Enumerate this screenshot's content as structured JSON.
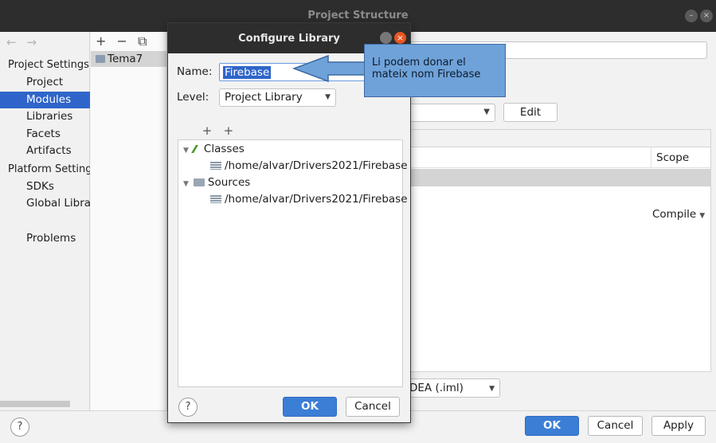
{
  "window": {
    "title": "Project Structure",
    "controls": [
      "minimize",
      "close"
    ]
  },
  "nav": {
    "back": "←",
    "forward": "→"
  },
  "sidebar": {
    "section_project": "Project Settings",
    "section_platform": "Platform Settings",
    "items_project": [
      {
        "label": "Project"
      },
      {
        "label": "Modules",
        "selected": true
      },
      {
        "label": "Libraries"
      },
      {
        "label": "Facets"
      },
      {
        "label": "Artifacts"
      }
    ],
    "items_platform": [
      {
        "label": "SDKs"
      },
      {
        "label": "Global Libraries"
      }
    ],
    "problems": "Problems"
  },
  "modules": {
    "tools": [
      "+",
      "−",
      "⧉"
    ],
    "items": [
      {
        "label": "Tema7"
      }
    ]
  },
  "module_panel": {
    "edit_label": "Edit",
    "scope_header": "Scope",
    "compile": "Compile",
    "storage_format": "DEA (.iml)"
  },
  "footer": {
    "help": "?",
    "ok": "OK",
    "cancel": "Cancel",
    "apply": "Apply"
  },
  "dialog": {
    "title": "Configure Library",
    "name_label": "Name:",
    "name_value": "Firebase",
    "level_label": "Level:",
    "level_value": "Project Library",
    "tools": [
      "+",
      "+",
      "+",
      "−"
    ],
    "tree": {
      "classes_label": "Classes",
      "classes_path": "/home/alvar/Drivers2021/Firebase",
      "sources_label": "Sources",
      "sources_path": "/home/alvar/Drivers2021/Firebase"
    },
    "help": "?",
    "ok": "OK",
    "cancel": "Cancel",
    "close": "×"
  },
  "callout": {
    "line1": "Li podem donar el",
    "line2": "mateix nom Firebase"
  },
  "colors": {
    "accent": "#2f65ca",
    "primary_button": "#3b7ed6",
    "titlebar": "#2d2d2d",
    "callout": "#6fa2d9",
    "close": "#e95420"
  }
}
